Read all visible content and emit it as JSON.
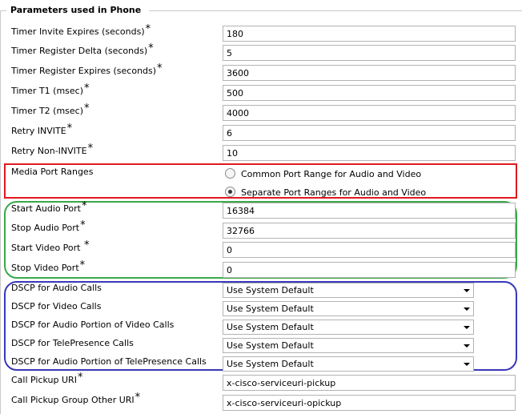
{
  "section": {
    "title": "Parameters used in Phone"
  },
  "required_marker": "*",
  "fields": [
    {
      "label": "Timer Invite Expires (seconds)",
      "required": true,
      "value": "180"
    },
    {
      "label": "Timer Register Delta (seconds)",
      "required": true,
      "value": "5"
    },
    {
      "label": "Timer Register Expires (seconds)",
      "required": true,
      "value": "3600"
    },
    {
      "label": "Timer T1 (msec)",
      "required": true,
      "value": "500"
    },
    {
      "label": "Timer T2 (msec)",
      "required": true,
      "value": "4000"
    },
    {
      "label": "Retry INVITE",
      "required": true,
      "value": "6"
    },
    {
      "label": "Retry Non-INVITE",
      "required": true,
      "value": "10"
    }
  ],
  "media_port_ranges": {
    "label": "Media Port Ranges",
    "options": [
      {
        "label": "Common Port Range for Audio and Video",
        "selected": false
      },
      {
        "label": "Separate Port Ranges for Audio and Video",
        "selected": true
      }
    ]
  },
  "ports": [
    {
      "label": "Start Audio Port",
      "required": true,
      "value": "16384"
    },
    {
      "label": "Stop Audio Port",
      "required": true,
      "value": "32766"
    },
    {
      "label": "Start Video Port ",
      "required": true,
      "value": "0"
    },
    {
      "label": "Stop Video Port",
      "required": true,
      "value": "0"
    }
  ],
  "dscp": [
    {
      "label": "DSCP for Audio Calls",
      "value": "Use System Default"
    },
    {
      "label": "DSCP for Video Calls",
      "value": "Use System Default"
    },
    {
      "label": "DSCP for Audio Portion of Video Calls",
      "value": "Use System Default"
    },
    {
      "label": "DSCP for TelePresence Calls",
      "value": "Use System Default"
    },
    {
      "label": "DSCP for Audio Portion of TelePresence Calls",
      "value": "Use System Default"
    }
  ],
  "pickup": [
    {
      "label": "Call Pickup URI",
      "required": true,
      "value": "x-cisco-serviceuri-pickup"
    },
    {
      "label": "Call Pickup Group Other URI",
      "required": true,
      "value": "x-cisco-serviceuri-opickup"
    }
  ],
  "colors": {
    "media_box": "#e0191f",
    "port_box": "#3aa84a",
    "dscp_box": "#3838b8"
  }
}
